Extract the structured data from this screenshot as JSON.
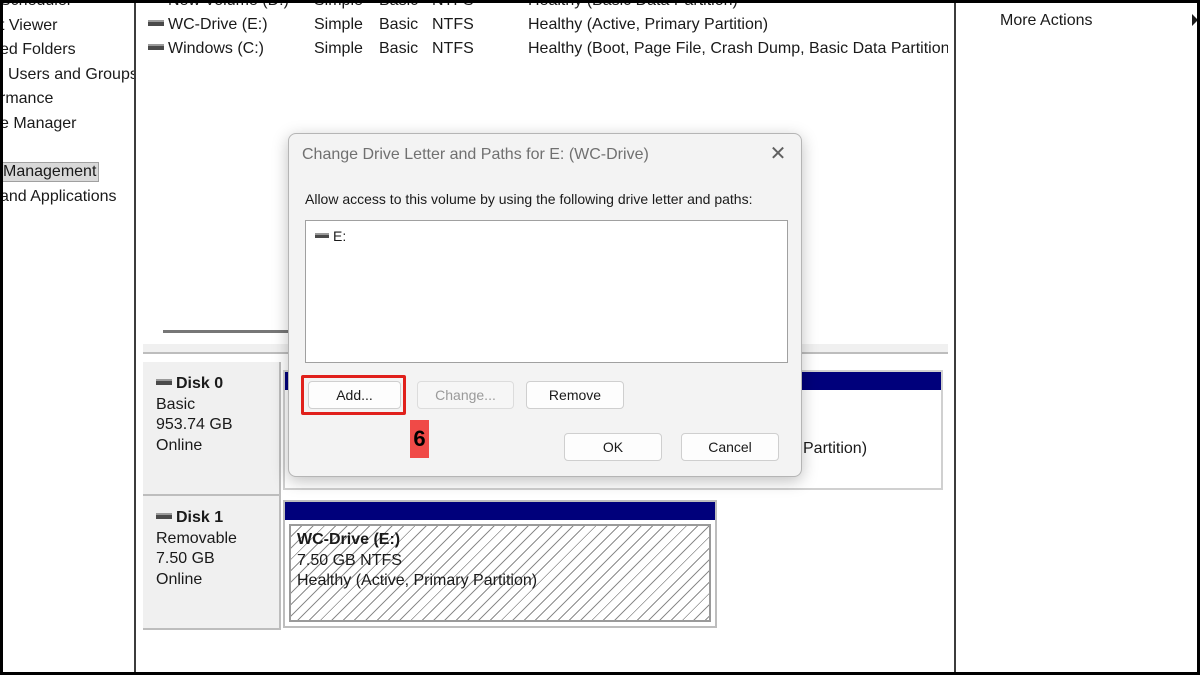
{
  "tree": {
    "items": [
      "Scheduler",
      "t Viewer",
      "ed Folders",
      "l Users and Groups",
      "rmance",
      "e Manager",
      "Management",
      "and Applications"
    ]
  },
  "volumes": [
    {
      "name": "New Volume (D:)",
      "layout": "Simple",
      "type": "Basic",
      "fs": "NTFS",
      "status": "Healthy (Basic Data Partition)"
    },
    {
      "name": "WC-Drive (E:)",
      "layout": "Simple",
      "type": "Basic",
      "fs": "NTFS",
      "status": "Healthy (Active, Primary Partition)"
    },
    {
      "name": "Windows (C:)",
      "layout": "Simple",
      "type": "Basic",
      "fs": "NTFS",
      "status": "Healthy (Boot, Page File, Crash Dump, Basic Data Partition)"
    }
  ],
  "disks": [
    {
      "name": "Disk 0",
      "kind": "Basic",
      "size": "953.74 GB",
      "state": "Online",
      "partial_status": "Partition)"
    },
    {
      "name": "Disk 1",
      "kind": "Removable",
      "size": "7.50 GB",
      "state": "Online"
    }
  ],
  "disk1_volume": {
    "title": "WC-Drive  (E:)",
    "size_fs": "7.50 GB NTFS",
    "status": "Healthy (Active, Primary Partition)"
  },
  "actions": {
    "more_actions": "More Actions"
  },
  "dialog": {
    "title": "Change Drive Letter and Paths for E: (WC-Drive)",
    "close_glyph": "✕",
    "description": "Allow access to this volume by using the following drive letter and paths:",
    "paths": [
      "E:"
    ],
    "add_label": "Add...",
    "change_label": "Change...",
    "remove_label": "Remove",
    "ok_label": "OK",
    "cancel_label": "Cancel"
  },
  "annotation": {
    "step": "6",
    "highlight_color": "#e0201b",
    "badge_color": "#f04a47"
  },
  "colors": {
    "volume_bar": "#00007b"
  }
}
